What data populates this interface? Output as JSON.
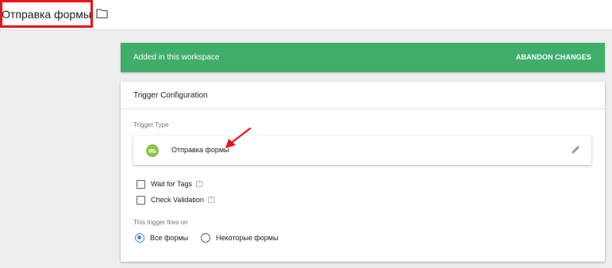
{
  "page": {
    "title": "Отправка формы",
    "folder_icon": "folder-icon",
    "highlight_color": "#e8141b"
  },
  "banner": {
    "text": "Added in this workspace",
    "action": "ABANDON CHANGES",
    "color": "#3fae6a"
  },
  "card": {
    "title": "Trigger Configuration",
    "trigger_type_label": "Trigger Type",
    "trigger_type": {
      "name": "Отправка формы",
      "icon": "form-submission-icon",
      "icon_color": "#8bc34a",
      "edit_icon": "pencil-icon"
    },
    "annotation_arrow_color": "#e8141b",
    "options": [
      {
        "label": "Wait for Tags",
        "checked": false,
        "help": "?"
      },
      {
        "label": "Check Validation",
        "checked": false,
        "help": "?"
      }
    ],
    "fires_on_label": "This trigger fires on",
    "fires_on": [
      {
        "label": "Все формы",
        "selected": true
      },
      {
        "label": "Некоторые формы",
        "selected": false
      }
    ],
    "accent_color": "#4285f4"
  }
}
